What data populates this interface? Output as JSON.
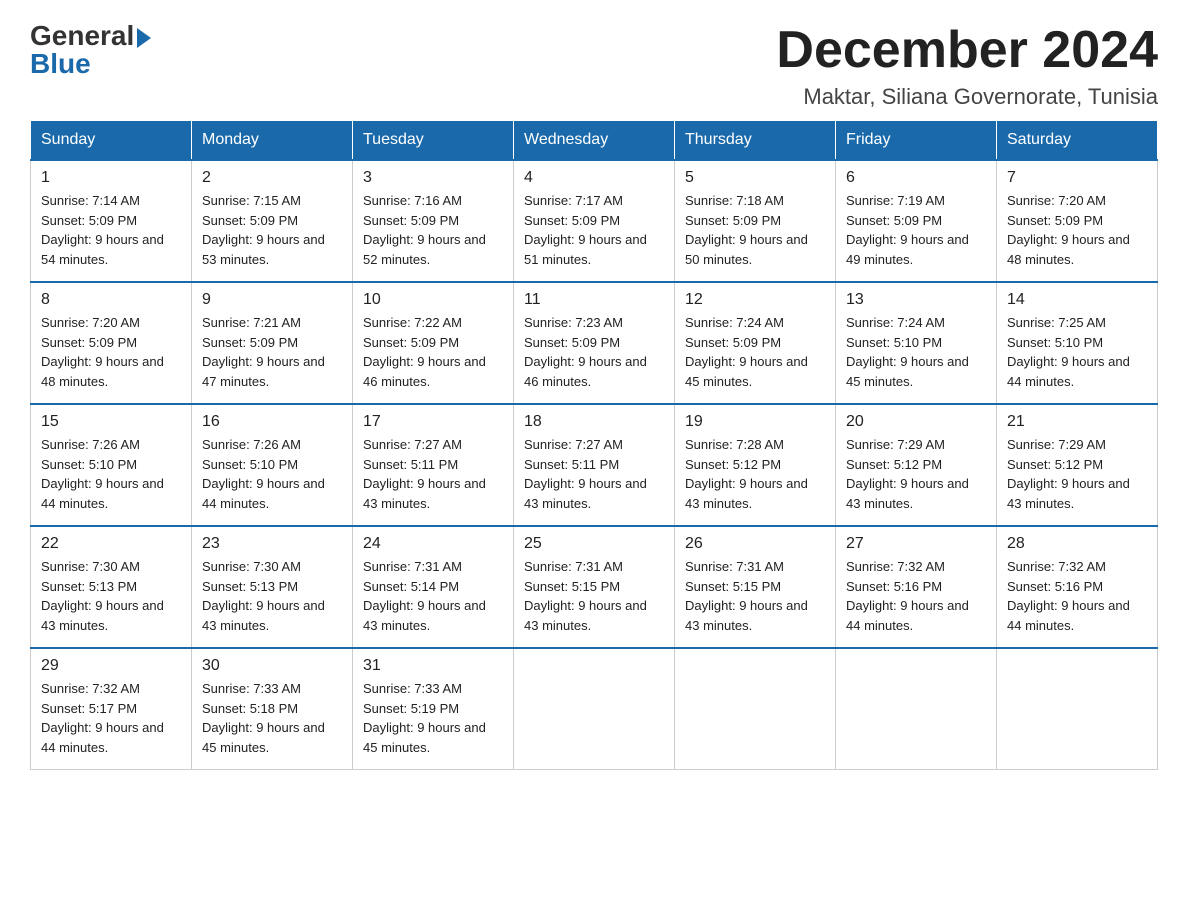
{
  "logo": {
    "general": "General",
    "blue": "Blue"
  },
  "header": {
    "month_title": "December 2024",
    "location": "Maktar, Siliana Governorate, Tunisia"
  },
  "weekdays": [
    "Sunday",
    "Monday",
    "Tuesday",
    "Wednesday",
    "Thursday",
    "Friday",
    "Saturday"
  ],
  "weeks": [
    [
      {
        "day": "1",
        "sunrise": "7:14 AM",
        "sunset": "5:09 PM",
        "daylight": "9 hours and 54 minutes."
      },
      {
        "day": "2",
        "sunrise": "7:15 AM",
        "sunset": "5:09 PM",
        "daylight": "9 hours and 53 minutes."
      },
      {
        "day": "3",
        "sunrise": "7:16 AM",
        "sunset": "5:09 PM",
        "daylight": "9 hours and 52 minutes."
      },
      {
        "day": "4",
        "sunrise": "7:17 AM",
        "sunset": "5:09 PM",
        "daylight": "9 hours and 51 minutes."
      },
      {
        "day": "5",
        "sunrise": "7:18 AM",
        "sunset": "5:09 PM",
        "daylight": "9 hours and 50 minutes."
      },
      {
        "day": "6",
        "sunrise": "7:19 AM",
        "sunset": "5:09 PM",
        "daylight": "9 hours and 49 minutes."
      },
      {
        "day": "7",
        "sunrise": "7:20 AM",
        "sunset": "5:09 PM",
        "daylight": "9 hours and 48 minutes."
      }
    ],
    [
      {
        "day": "8",
        "sunrise": "7:20 AM",
        "sunset": "5:09 PM",
        "daylight": "9 hours and 48 minutes."
      },
      {
        "day": "9",
        "sunrise": "7:21 AM",
        "sunset": "5:09 PM",
        "daylight": "9 hours and 47 minutes."
      },
      {
        "day": "10",
        "sunrise": "7:22 AM",
        "sunset": "5:09 PM",
        "daylight": "9 hours and 46 minutes."
      },
      {
        "day": "11",
        "sunrise": "7:23 AM",
        "sunset": "5:09 PM",
        "daylight": "9 hours and 46 minutes."
      },
      {
        "day": "12",
        "sunrise": "7:24 AM",
        "sunset": "5:09 PM",
        "daylight": "9 hours and 45 minutes."
      },
      {
        "day": "13",
        "sunrise": "7:24 AM",
        "sunset": "5:10 PM",
        "daylight": "9 hours and 45 minutes."
      },
      {
        "day": "14",
        "sunrise": "7:25 AM",
        "sunset": "5:10 PM",
        "daylight": "9 hours and 44 minutes."
      }
    ],
    [
      {
        "day": "15",
        "sunrise": "7:26 AM",
        "sunset": "5:10 PM",
        "daylight": "9 hours and 44 minutes."
      },
      {
        "day": "16",
        "sunrise": "7:26 AM",
        "sunset": "5:10 PM",
        "daylight": "9 hours and 44 minutes."
      },
      {
        "day": "17",
        "sunrise": "7:27 AM",
        "sunset": "5:11 PM",
        "daylight": "9 hours and 43 minutes."
      },
      {
        "day": "18",
        "sunrise": "7:27 AM",
        "sunset": "5:11 PM",
        "daylight": "9 hours and 43 minutes."
      },
      {
        "day": "19",
        "sunrise": "7:28 AM",
        "sunset": "5:12 PM",
        "daylight": "9 hours and 43 minutes."
      },
      {
        "day": "20",
        "sunrise": "7:29 AM",
        "sunset": "5:12 PM",
        "daylight": "9 hours and 43 minutes."
      },
      {
        "day": "21",
        "sunrise": "7:29 AM",
        "sunset": "5:12 PM",
        "daylight": "9 hours and 43 minutes."
      }
    ],
    [
      {
        "day": "22",
        "sunrise": "7:30 AM",
        "sunset": "5:13 PM",
        "daylight": "9 hours and 43 minutes."
      },
      {
        "day": "23",
        "sunrise": "7:30 AM",
        "sunset": "5:13 PM",
        "daylight": "9 hours and 43 minutes."
      },
      {
        "day": "24",
        "sunrise": "7:31 AM",
        "sunset": "5:14 PM",
        "daylight": "9 hours and 43 minutes."
      },
      {
        "day": "25",
        "sunrise": "7:31 AM",
        "sunset": "5:15 PM",
        "daylight": "9 hours and 43 minutes."
      },
      {
        "day": "26",
        "sunrise": "7:31 AM",
        "sunset": "5:15 PM",
        "daylight": "9 hours and 43 minutes."
      },
      {
        "day": "27",
        "sunrise": "7:32 AM",
        "sunset": "5:16 PM",
        "daylight": "9 hours and 44 minutes."
      },
      {
        "day": "28",
        "sunrise": "7:32 AM",
        "sunset": "5:16 PM",
        "daylight": "9 hours and 44 minutes."
      }
    ],
    [
      {
        "day": "29",
        "sunrise": "7:32 AM",
        "sunset": "5:17 PM",
        "daylight": "9 hours and 44 minutes."
      },
      {
        "day": "30",
        "sunrise": "7:33 AM",
        "sunset": "5:18 PM",
        "daylight": "9 hours and 45 minutes."
      },
      {
        "day": "31",
        "sunrise": "7:33 AM",
        "sunset": "5:19 PM",
        "daylight": "9 hours and 45 minutes."
      },
      null,
      null,
      null,
      null
    ]
  ]
}
